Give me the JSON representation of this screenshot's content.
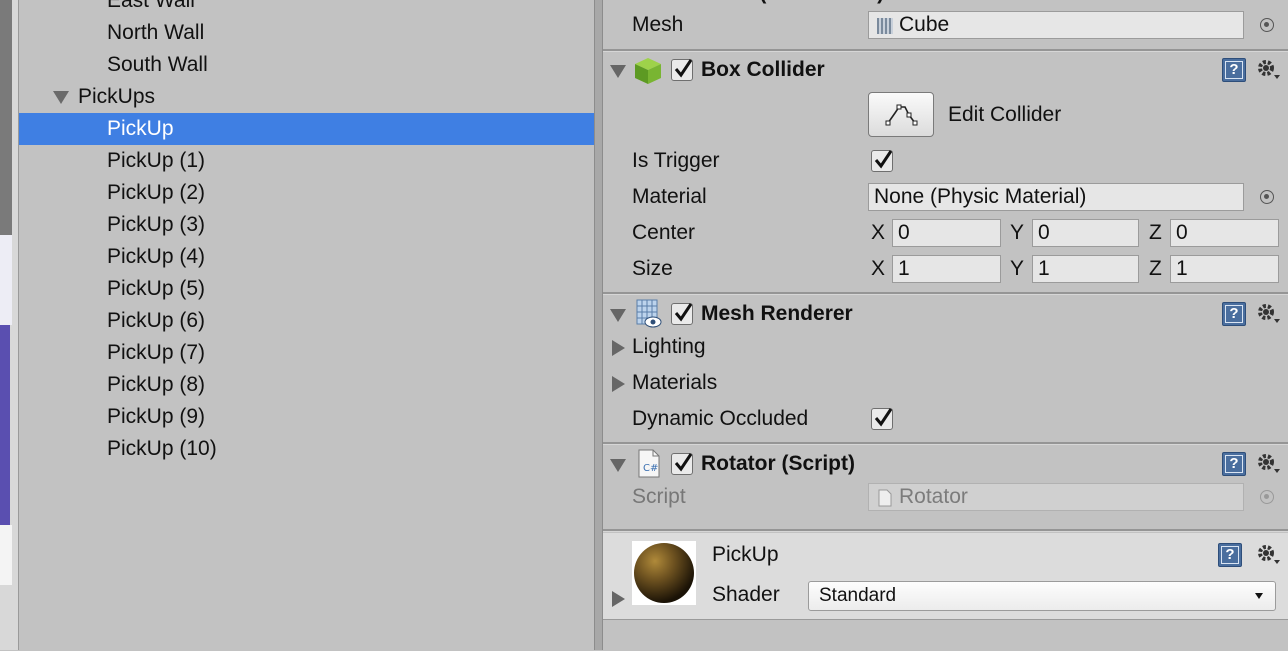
{
  "hierarchy": {
    "items": [
      {
        "label": "East Wall",
        "level": 2
      },
      {
        "label": "North Wall",
        "level": 2
      },
      {
        "label": "South Wall",
        "level": 2
      },
      {
        "label": "PickUps",
        "level": 1,
        "expanded": true
      },
      {
        "label": "PickUp",
        "level": 2,
        "selected": true
      },
      {
        "label": "PickUp (1)",
        "level": 2
      },
      {
        "label": "PickUp (2)",
        "level": 2
      },
      {
        "label": "PickUp (3)",
        "level": 2
      },
      {
        "label": "PickUp (4)",
        "level": 2
      },
      {
        "label": "PickUp (5)",
        "level": 2
      },
      {
        "label": "PickUp (6)",
        "level": 2
      },
      {
        "label": "PickUp (7)",
        "level": 2
      },
      {
        "label": "PickUp (8)",
        "level": 2
      },
      {
        "label": "PickUp (9)",
        "level": 2
      },
      {
        "label": "PickUp (10)",
        "level": 2
      }
    ],
    "selected_color": "#3f7fe3"
  },
  "inspector": {
    "mesh_filter": {
      "title": "Cube (Mesh Filter)",
      "mesh_label": "Mesh",
      "mesh_value": "Cube"
    },
    "box_collider": {
      "title": "Box Collider",
      "enabled": true,
      "edit_collider_label": "Edit Collider",
      "is_trigger_label": "Is Trigger",
      "is_trigger": true,
      "material_label": "Material",
      "material_value": "None (Physic Material)",
      "center_label": "Center",
      "center": {
        "x": "0",
        "y": "0",
        "z": "0"
      },
      "size_label": "Size",
      "size": {
        "x": "1",
        "y": "1",
        "z": "1"
      },
      "axis_labels": {
        "x": "X",
        "y": "Y",
        "z": "Z"
      }
    },
    "mesh_renderer": {
      "title": "Mesh Renderer",
      "enabled": true,
      "lighting_label": "Lighting",
      "materials_label": "Materials",
      "dynamic_occluded_label": "Dynamic Occluded",
      "dynamic_occluded": true
    },
    "rotator": {
      "title": "Rotator (Script)",
      "enabled": true,
      "script_label": "Script",
      "script_value": "Rotator"
    },
    "material": {
      "name": "PickUp",
      "shader_label": "Shader",
      "shader_value": "Standard"
    },
    "help_icon_text": "?"
  },
  "icons": {
    "box_collider": "green-cube-icon",
    "mesh_renderer": "mesh-grid-icon",
    "script": "csharp-script-icon",
    "help": "help-book-icon",
    "settings": "gear-icon",
    "object_picker": "object-picker-icon"
  }
}
